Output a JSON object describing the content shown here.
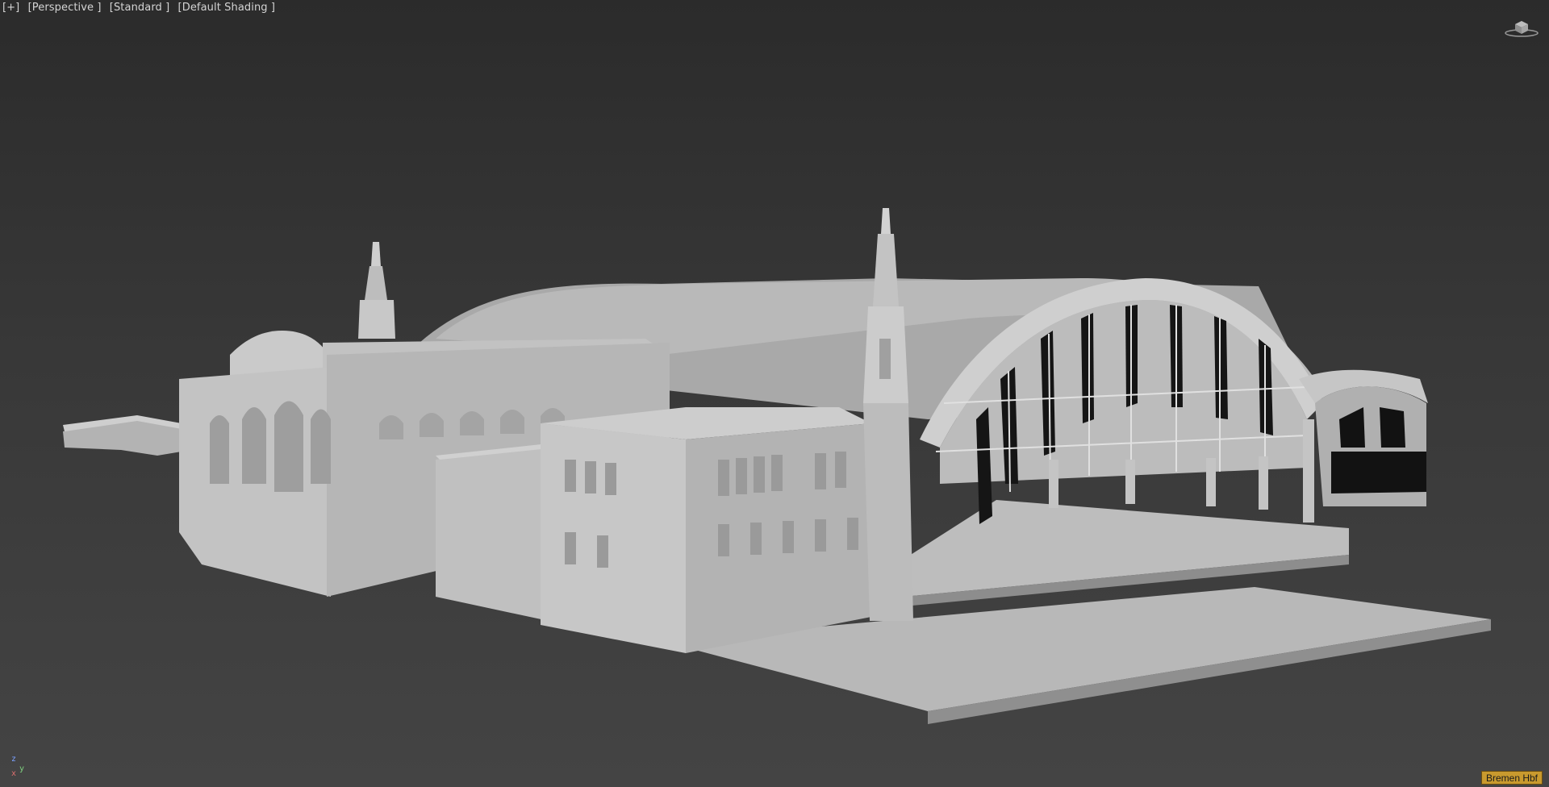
{
  "viewport": {
    "menu_label": "[+]",
    "view_label": "[Perspective ]",
    "render_mode_label": "[Standard ]",
    "shading_label": "[Default Shading ]"
  },
  "axis": {
    "z": "z",
    "y": "y",
    "x": "x"
  },
  "object_tag": "Bremen Hbf",
  "colors": {
    "background_top": "#2b2b2b",
    "background_bottom": "#444444",
    "model_light": "#c8c8c8",
    "model_mid": "#a8a8a8",
    "model_dark": "#8a8a8a",
    "object_tag_bg": "#c99a2e"
  },
  "icons": [
    "viewcube-icon",
    "axis-tripod-icon"
  ]
}
